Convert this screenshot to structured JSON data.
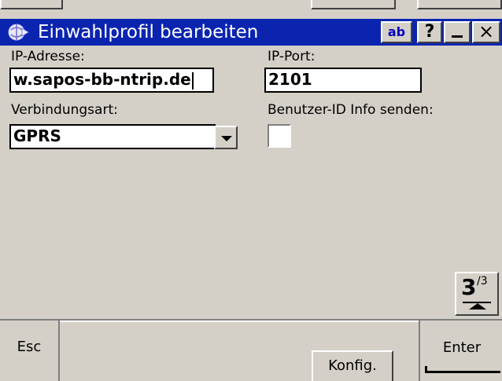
{
  "window": {
    "title": "Einwahlprofil bearbeiten",
    "ab_button": {
      "a": "a",
      "b": "b"
    },
    "help_label": "?",
    "close_label": "×"
  },
  "form": {
    "ip_address": {
      "label": "IP-Adresse:",
      "value": "w.sapos-bb-ntrip.de"
    },
    "ip_port": {
      "label": "IP-Port:",
      "value": "2101"
    },
    "connection_type": {
      "label": "Verbindungsart:",
      "value": "GPRS"
    },
    "send_user_id": {
      "label": "Benutzer-ID Info senden:",
      "checked": false
    }
  },
  "pager": {
    "current": "3",
    "total": "/3"
  },
  "softkeys": {
    "esc": "Esc",
    "konfig": "Konfig.",
    "enter": "Enter"
  },
  "colors": {
    "titlebar": "#0a24b0",
    "background": "#d4d0c8"
  }
}
